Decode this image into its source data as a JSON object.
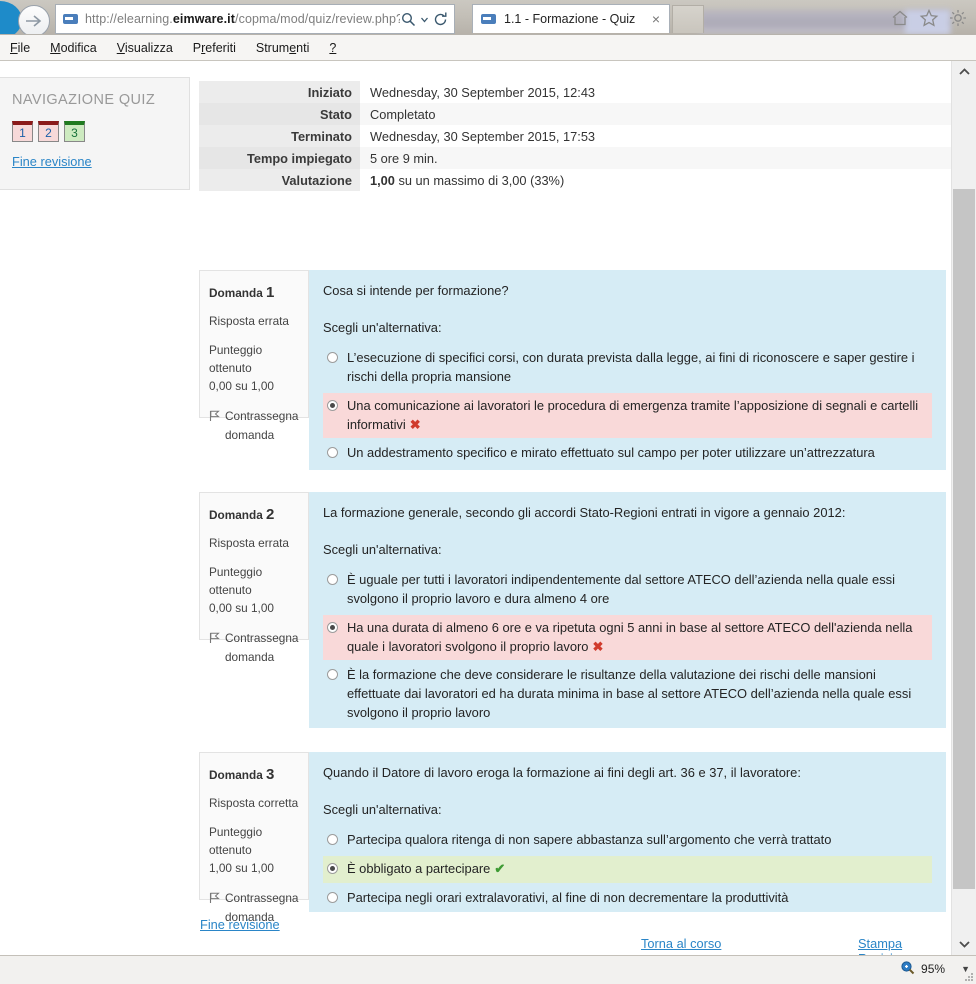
{
  "browser": {
    "address": {
      "prefix": "http://elearning.",
      "domain": "eimware.it",
      "suffix": "/copma/mod/quiz/review.php?attem",
      "full": "http://elearning.eimware.it/copma/mod/quiz/review.php?attem"
    },
    "tab_title": "1.1 - Formazione - Quiz",
    "menu": [
      {
        "label": "File",
        "accel": "F"
      },
      {
        "label": "Modifica",
        "accel": "M"
      },
      {
        "label": "Visualizza",
        "accel": "V"
      },
      {
        "label": "Preferiti",
        "accel": "r"
      },
      {
        "label": "Strumenti",
        "accel": "e"
      },
      {
        "label": "?",
        "accel": "?"
      }
    ],
    "zoom_level": "95%"
  },
  "nav": {
    "title": "NAVIGAZIONE QUIZ",
    "buttons": [
      {
        "label": "1",
        "state": "wrong"
      },
      {
        "label": "2",
        "state": "wrong"
      },
      {
        "label": "3",
        "state": "right"
      }
    ],
    "end_review_link": "Fine revisione"
  },
  "summary": {
    "rows": [
      {
        "key": "Iniziato",
        "value": "Wednesday, 30 September 2015, 12:43"
      },
      {
        "key": "Stato",
        "value": "Completato"
      },
      {
        "key": "Terminato",
        "value": "Wednesday, 30 September 2015, 17:53"
      },
      {
        "key": "Tempo impiegato",
        "value": "5 ore 9 min."
      }
    ],
    "grade_key": "Valutazione",
    "grade_bold": "1,00",
    "grade_rest": " su un massimo di 3,00 (33%)"
  },
  "labels": {
    "question_word": "Domanda",
    "score_label": "Punteggio ottenuto",
    "flag_label": "Contrassegna domanda",
    "choose_prompt": "Scegli un'alternativa:"
  },
  "questions": [
    {
      "number": "1",
      "state": "Risposta errata",
      "score": "0,00 su 1,00",
      "text": "Cosa si intende per formazione?",
      "answers": [
        {
          "text": "L’esecuzione di specifici corsi, con durata prevista dalla legge, ai fini di riconoscere e saper gestire i rischi della propria mansione",
          "selected": false,
          "status": "none",
          "mark": ""
        },
        {
          "text": "Una comunicazione ai lavoratori le procedura di emergenza tramite l’apposizione di segnali e cartelli informativi",
          "selected": true,
          "status": "wrong",
          "mark": "✖"
        },
        {
          "text": "Un addestramento specifico e mirato effettuato sul campo per poter utilizzare un’attrezzatura",
          "selected": false,
          "status": "none",
          "mark": ""
        }
      ]
    },
    {
      "number": "2",
      "state": "Risposta errata",
      "score": "0,00 su 1,00",
      "text": "La formazione generale, secondo gli accordi Stato-Regioni entrati in vigore a gennaio 2012:",
      "answers": [
        {
          "text": "È uguale per tutti i lavoratori indipendentemente dal settore ATECO dell’azienda nella quale essi svolgono il proprio lavoro e dura almeno 4 ore",
          "selected": false,
          "status": "none",
          "mark": ""
        },
        {
          "text": "Ha una durata di almeno 6 ore e va ripetuta ogni 5 anni in base al settore ATECO  dell'azienda nella quale i lavoratori svolgono il proprio lavoro",
          "selected": true,
          "status": "wrong",
          "mark": "✖"
        },
        {
          "text": "È la formazione che deve considerare le risultanze della valutazione dei rischi delle mansioni effettuate dai lavoratori ed ha durata minima in base al settore ATECO  dell’azienda nella quale essi svolgono il proprio lavoro",
          "selected": false,
          "status": "none",
          "mark": ""
        }
      ]
    },
    {
      "number": "3",
      "state": "Risposta corretta",
      "score": "1,00 su 1,00",
      "text": "Quando il Datore di lavoro eroga la formazione ai fini degli art. 36 e 37, il lavoratore:",
      "answers": [
        {
          "text": "Partecipa qualora ritenga di non sapere abbastanza sull’argomento che verrà trattato",
          "selected": false,
          "status": "none",
          "mark": ""
        },
        {
          "text": "È obbligato a partecipare",
          "selected": true,
          "status": "correct",
          "mark": "✔"
        },
        {
          "text": "Partecipa negli orari extralavorativi, al fine di non decrementare la produttività",
          "selected": false,
          "status": "none",
          "mark": ""
        }
      ]
    }
  ],
  "bottom_links": {
    "end_review": "Fine revisione",
    "back_to_course": "Torna al corso",
    "print_review": "Stampa Revisione"
  },
  "colors": {
    "question_bg": "#d6ecf5",
    "wrong_bg": "#f9d9d9",
    "correct_bg": "#e2efce",
    "link": "#2a85c7",
    "accent_blue": "#1e8bc9"
  }
}
